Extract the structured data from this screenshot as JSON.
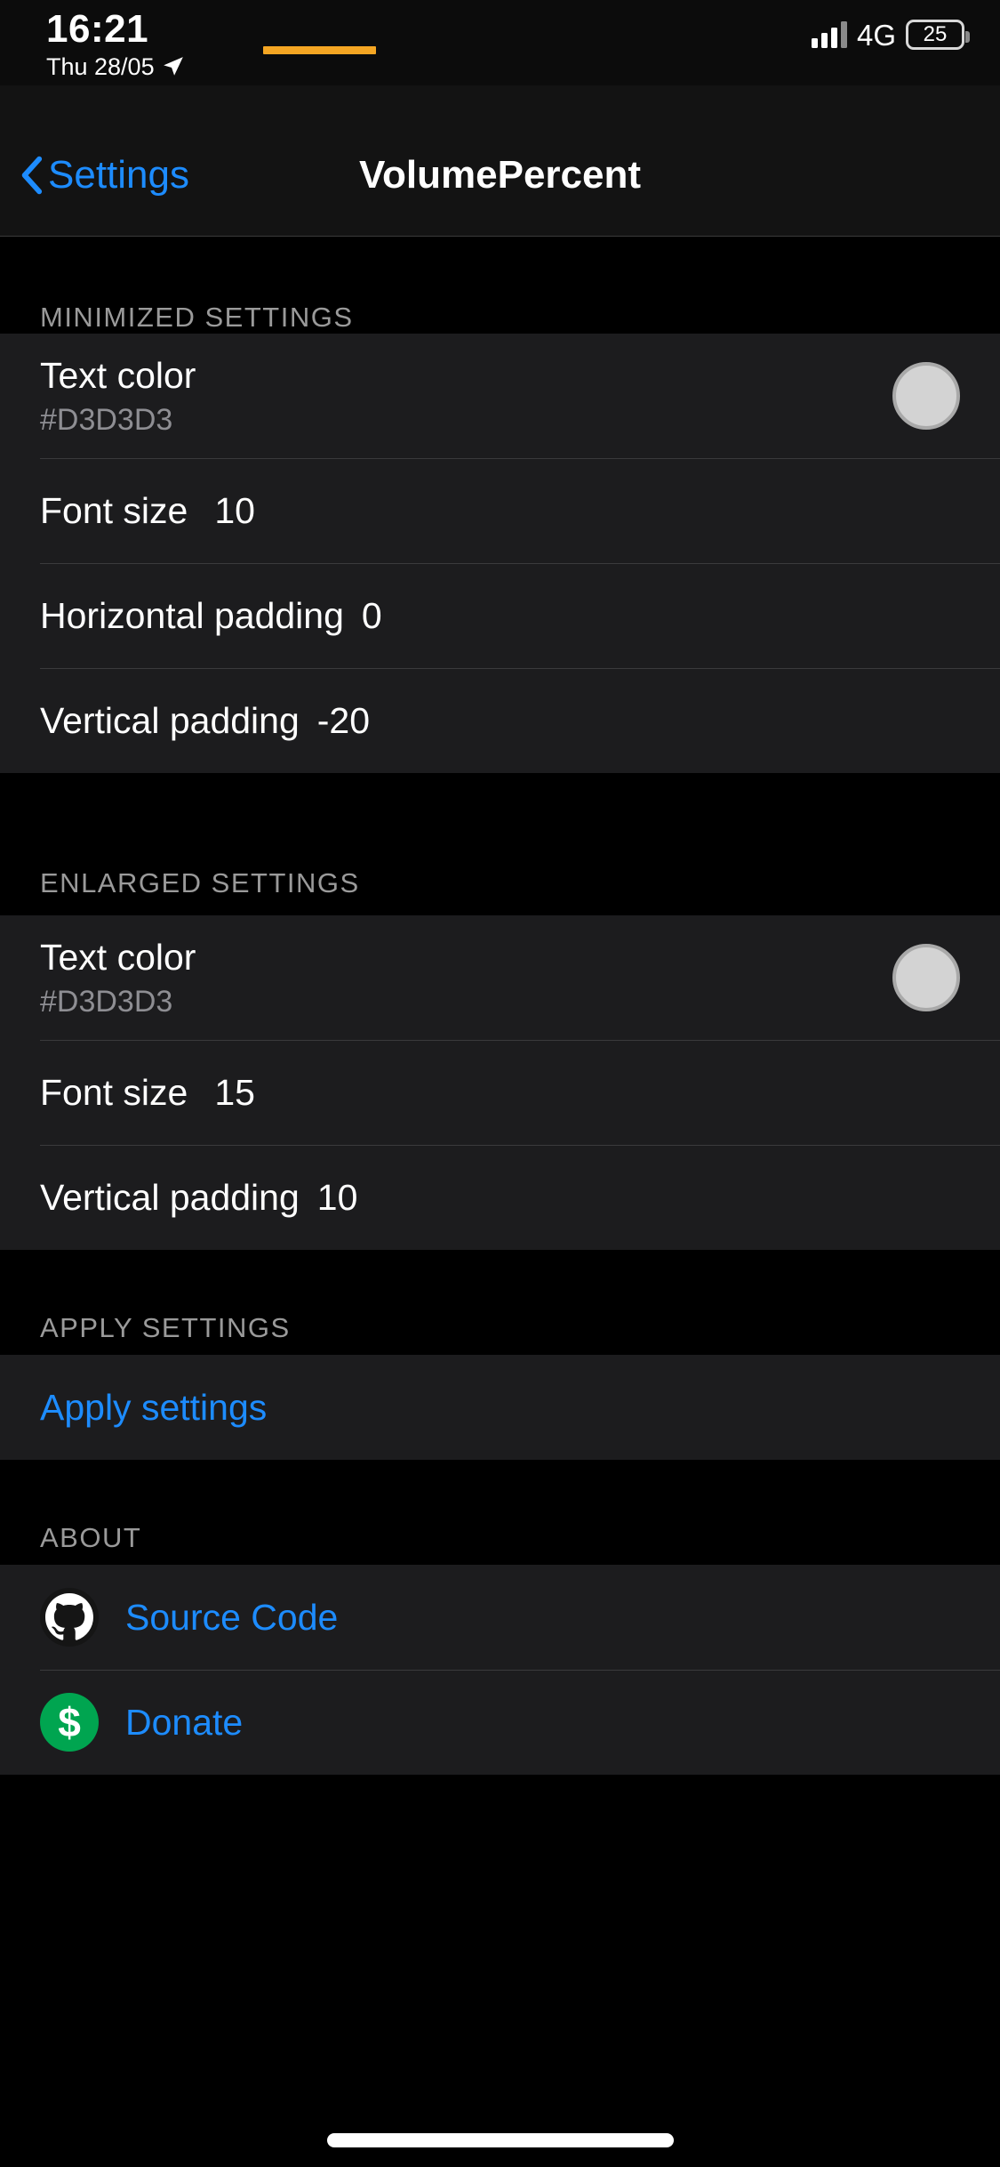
{
  "status_bar": {
    "time": "16:21",
    "date": "Thu 28/05",
    "location_icon": "location-arrow-icon",
    "signal_icon": "cellular-signal-icon",
    "network": "4G",
    "battery_percent": "25"
  },
  "nav_bar": {
    "back_icon": "chevron-left-icon",
    "back_label": "Settings",
    "title": "VolumePercent"
  },
  "sections": [
    {
      "header": "MINIMIZED SETTINGS",
      "rows": [
        {
          "type": "color",
          "label": "Text color",
          "sub": "#D3D3D3",
          "swatch": "#D3D3D3"
        },
        {
          "type": "value",
          "label": "Font size",
          "value": "10"
        },
        {
          "type": "value",
          "label": "Horizontal padding",
          "value": "0"
        },
        {
          "type": "value",
          "label": "Vertical padding",
          "value": "-20"
        }
      ]
    },
    {
      "header": "ENLARGED SETTINGS",
      "rows": [
        {
          "type": "color",
          "label": "Text color",
          "sub": "#D3D3D3",
          "swatch": "#D3D3D3"
        },
        {
          "type": "value",
          "label": "Font size",
          "value": "15"
        },
        {
          "type": "value",
          "label": "Vertical padding",
          "value": "10"
        }
      ]
    },
    {
      "header": "APPLY SETTINGS",
      "rows": [
        {
          "type": "link",
          "label": "Apply settings"
        }
      ]
    },
    {
      "header": "ABOUT",
      "rows": [
        {
          "type": "icon-link",
          "label": "Source Code",
          "icon": "github-icon"
        },
        {
          "type": "icon-link",
          "label": "Donate",
          "icon": "dollar-icon",
          "glyph": "$"
        }
      ]
    }
  ],
  "colors": {
    "accent_blue": "#1D8CFF",
    "orange_bar": "#F5A623",
    "cell_background": "#1C1C1E",
    "page_background": "#000000",
    "donate_green": "#00A550",
    "swatch_gray": "#D3D3D3"
  },
  "home_indicator": "home-indicator"
}
